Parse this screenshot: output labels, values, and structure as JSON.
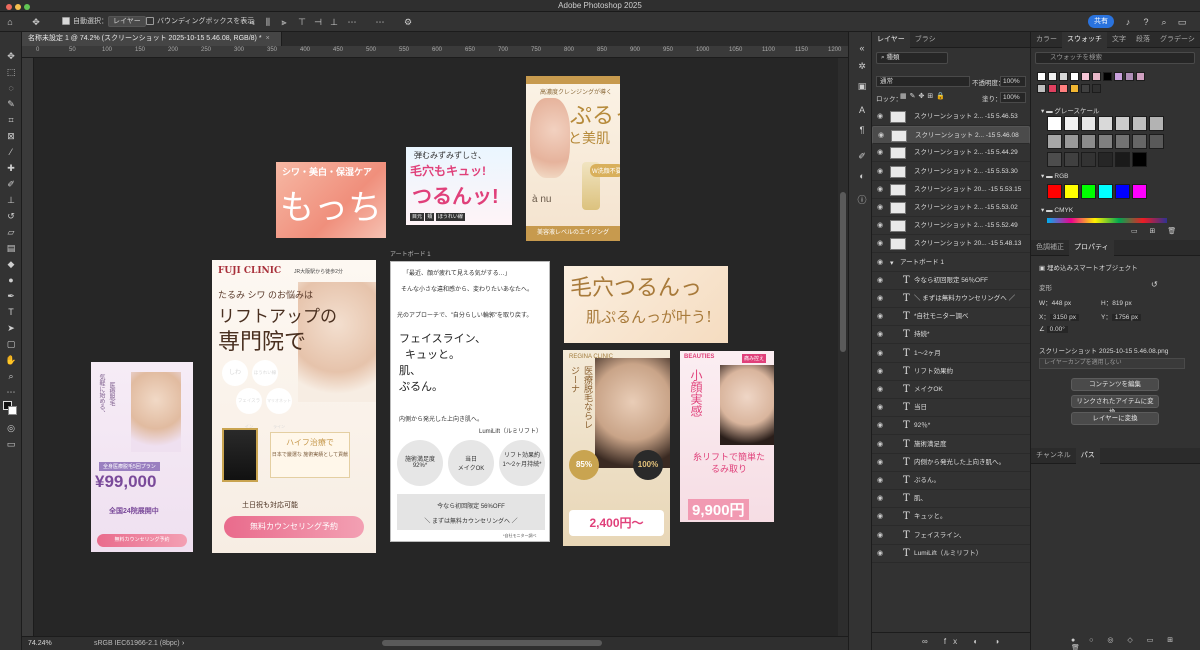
{
  "app": {
    "title": "Adobe Photoshop 2025"
  },
  "optbar": {
    "auto_select_label": "自動選択：",
    "layer_select": "レイヤー",
    "bbox_label": "バウンディングボックスを表示",
    "share_label": "共有"
  },
  "doc": {
    "tab_title": "名称未設定 1 @ 74.2% (スクリーンショット 2025-10-15 5.46.08, RGB/8) *",
    "zoom": "74.24%",
    "profile": "sRGB IEC61966-2.1 (8bpc)"
  },
  "ruler": {
    "h_ticks": [
      "0",
      "50",
      "100",
      "150",
      "200",
      "250",
      "300",
      "350",
      "400",
      "450",
      "500",
      "550",
      "600",
      "650",
      "700",
      "750",
      "800",
      "850",
      "900",
      "950",
      "1000",
      "1050",
      "1100",
      "1150",
      "1200",
      "1250"
    ]
  },
  "canvas": {
    "artboard_label": "アートボード 1",
    "pink_banner": {
      "line1": "シワ・美白・保湿ケア",
      "big": "もっちり"
    },
    "pore_card": {
      "line1": "弾むみずみずしさ、",
      "line2": "毛穴もキュッ!",
      "big": "つるんッ!",
      "chips": [
        "目元",
        "頬",
        "ほうれい線"
      ]
    },
    "tall_ad": {
      "line1": "高濃度クレンジングが導く",
      "big1": "ぷるっ",
      "big2": "と美肌",
      "brand": "à nu",
      "sub": "W洗顔不要",
      "footer": "美容液レベルのエイジング"
    },
    "fuji": {
      "logo": "FUJI CLINIC",
      "sub": "JR大阪駅から徒歩2分",
      "h1": "たるみ シワ のお悩みは",
      "h2": "リフトアップの",
      "h3": "専門院で",
      "bubbles": [
        "しわ",
        "ほうれい線",
        "フェイスライン",
        "マリオネットライン"
      ],
      "hifu": "ハイフ治療で",
      "hifu_sub": "日本で厳選な 施術実績として貢献",
      "sat": "土日祝も対応可能",
      "cta": "無料カウンセリング予約"
    },
    "text_ab": {
      "line1": "「最近、顔が疲れて見える気がする…」",
      "line2": "そんな小さな違和感から、変わりたいあなたへ。",
      "line3": "光のアプローチで、\"自分らしい輪郭\"を取り戻す。",
      "big": [
        "フェイスライン、",
        "キュッと。",
        "肌、",
        "ぷるん。"
      ],
      "line4": "内側から発光した上向き肌へ。",
      "brand": "LumiLift（ルミリフト）",
      "circles": [
        {
          "a": "施術満足度",
          "b": "92%*"
        },
        {
          "a": "当日",
          "b": "メイクOK"
        },
        {
          "a": "リフト効果約",
          "b": "1〜2ヶ月持続*"
        }
      ],
      "box1": "今なら初回限定 56%OFF",
      "box2": "＼ まずは無料カウンセリングへ ／",
      "note": "*自社モニター調べ"
    },
    "pore_banner": {
      "l1": "毛穴つるんっ",
      "l2": "肌ぷるんっが叶う!"
    },
    "left_ad": {
      "v1": "気軽に始める、",
      "v2": "医療脱毛",
      "price": "¥99,000",
      "plan": "全身医療脱毛5回プラン",
      "clinics": "全国24院展開中",
      "cta": "無料カウンセリング予約"
    },
    "regina": {
      "logo": "REGINA CLINIC",
      "big": "医療脱毛ならレジーナ",
      "pct": "85%",
      "price": "2,400円〜",
      "badge": "100%"
    },
    "beauties": {
      "brand": "BEAUTIES",
      "tag": "痛み控え",
      "v1": "小顔実感",
      "mid": "糸リフトで簡単たるみ取り",
      "price": "9,900円"
    }
  },
  "layers": {
    "tabs": [
      "レイヤー",
      "ブラシ"
    ],
    "kind": "種類",
    "blend": "通常",
    "opacity_label": "不透明度：",
    "opacity": "100%",
    "lock_label": "ロック：",
    "fill_label": "塗り：",
    "fill": "100%",
    "rows": [
      {
        "name": "スクリーンショット 2... -15 5.46.53",
        "type": "img"
      },
      {
        "name": "スクリーンショット 2... -15 5.46.08",
        "type": "img",
        "selected": true
      },
      {
        "name": "スクリーンショット 2... -15 5.44.29",
        "type": "img"
      },
      {
        "name": "スクリーンショット 2... -15 5.53.30",
        "type": "img"
      },
      {
        "name": "スクリーンショット 20... -15 5.53.15",
        "type": "img"
      },
      {
        "name": "スクリーンショット 2... -15 5.53.02",
        "type": "img"
      },
      {
        "name": "スクリーンショット 2... -15 5.52.49",
        "type": "img"
      },
      {
        "name": "スクリーンショット 20... -15 5.48.13",
        "type": "img"
      },
      {
        "name": "アートボード 1",
        "type": "group"
      },
      {
        "name": "今なら初回限定 56％OFF",
        "type": "text"
      },
      {
        "name": "＼ まずは無料カウンセリングへ ／",
        "type": "text"
      },
      {
        "name": "*自社モニター調べ",
        "type": "text"
      },
      {
        "name": "持続*",
        "type": "text"
      },
      {
        "name": "1〜2ヶ月",
        "type": "text"
      },
      {
        "name": "リフト効果約",
        "type": "text"
      },
      {
        "name": "メイクOK",
        "type": "text"
      },
      {
        "name": "当日",
        "type": "text"
      },
      {
        "name": "92％*",
        "type": "text"
      },
      {
        "name": "施術満足度",
        "type": "text"
      },
      {
        "name": "内側から発光した上向き肌へ。",
        "type": "text"
      },
      {
        "name": "ぷるん。",
        "type": "text"
      },
      {
        "name": "肌、",
        "type": "text"
      },
      {
        "name": "キュッと。",
        "type": "text"
      },
      {
        "name": "フェイスライン、",
        "type": "text"
      },
      {
        "name": "LumiLift（ルミリフト）",
        "type": "text"
      }
    ]
  },
  "swatches": {
    "tabs": [
      "カラー",
      "スウォッチ",
      "文字",
      "段落",
      "グラデーシ"
    ],
    "search_placeholder": "スウォッチを検索",
    "groups": [
      "グレースケール",
      "RGB",
      "CMYK"
    ]
  },
  "props": {
    "tabs": [
      "色調補正",
      "プロパティ"
    ],
    "object_type": "埋め込みスマートオブジェクト",
    "transform": "変形",
    "w_label": "W：",
    "w": "448 px",
    "h_label": "H：",
    "h": "819 px",
    "x_label": "X：",
    "x": "3150 px",
    "y_label": "Y：",
    "y": "1756 px",
    "angle": "0.00°",
    "file": "スクリーンショット 2025-10-15 5.46.08.png",
    "comp": "レイヤーカンプを適用しない",
    "btn1": "コンテンツを編集",
    "btn2": "リンクされたアイテムに変換...",
    "btn3": "レイヤーに変換"
  },
  "channels": {
    "tabs": [
      "チャンネル",
      "パス"
    ]
  }
}
